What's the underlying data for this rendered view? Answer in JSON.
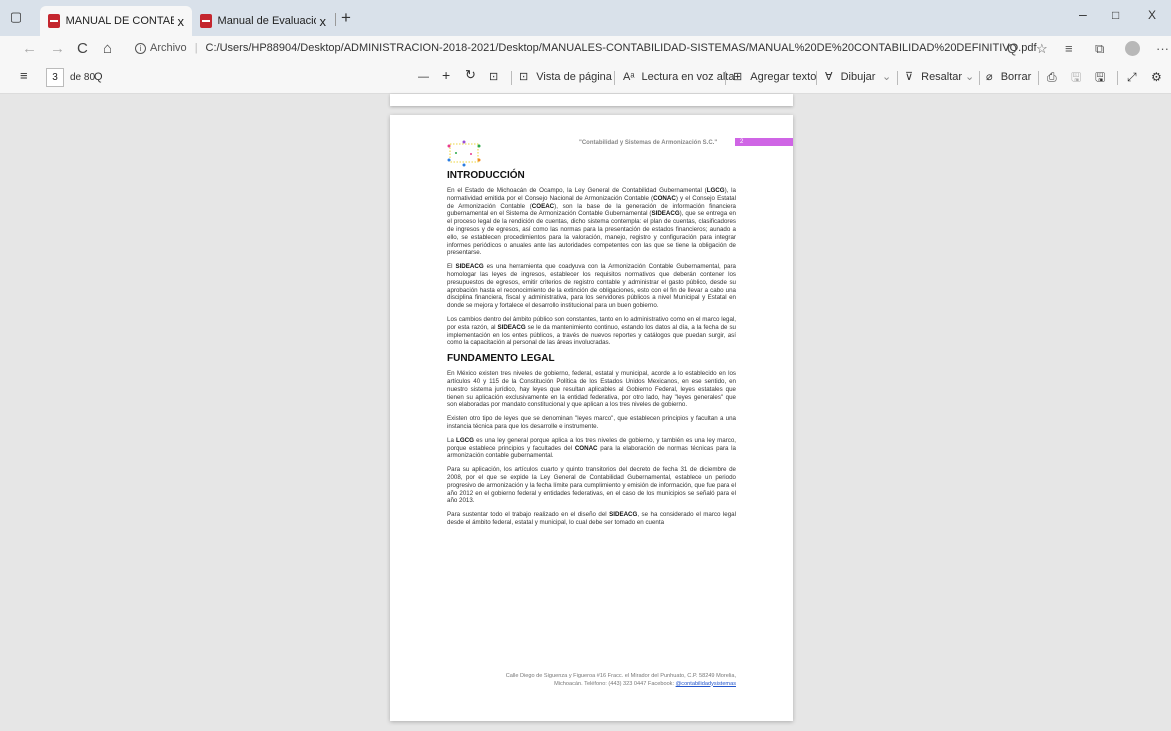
{
  "tabs": [
    {
      "title": "MANUAL DE CONTABILIDAD DE"
    },
    {
      "title": "Manual de Evaluación de Avance"
    }
  ],
  "icons": {
    "back": "←",
    "forward": "→",
    "refresh": "C",
    "home": "⌂",
    "close_tab": "x",
    "new_tab": "+",
    "min": "–",
    "max": "□",
    "close_win": "X",
    "zoom_url": "Q",
    "favorite": "☆",
    "favorites_bar": "≡",
    "collections": "⧉",
    "more": "···",
    "toc": "≡",
    "search": "Q",
    "zoom_out": "—",
    "zoom_in": "+",
    "rotate": "↻",
    "fit": "⊡",
    "page_view": "⊡",
    "read_aloud": "Aᵃ",
    "add_text": "⊞",
    "draw": "∀",
    "highlight": "⊽",
    "chevron": "⌄",
    "erase": "⌀",
    "print": "⎙",
    "save": "🖫",
    "save_as": "🖫",
    "fullscreen": "⤢",
    "settings": "⚙"
  },
  "address": {
    "scheme": "Archivo",
    "url": "C:/Users/HP88904/Desktop/ADMINISTRACION-2018-2021/Desktop/MANUALES-CONTABILIDAD-SISTEMAS/MANUAL%20DE%20CONTABILIDAD%20DEFINITIVO.pdf"
  },
  "pdf_toolbar": {
    "current_page": "3",
    "total_pages": "de 80",
    "page_view": "Vista de página",
    "read_aloud": "Lectura en voz alta",
    "add_text": "Agregar texto",
    "draw": "Dibujar",
    "highlight": "Resaltar",
    "erase": "Borrar"
  },
  "document": {
    "header_text": "\"Contabilidad y Sistemas de Armonización S.C.\"",
    "page_number": "2",
    "sections": {
      "introduccion": {
        "title": "INTRODUCCIÓN",
        "p1": "En el Estado de Michoacán de Ocampo, la Ley General de Contabilidad Gubernamental (LGCG), la normatividad emitida por el Consejo Nacional de Armonización Contable (CONAC) y el Consejo Estatal de Armonización Contable (COEAC), son la base de la generación de información financiera gubernamental en el Sistema de Armonización Contable Gubernamental (SIDEACG), que se entrega en el proceso legal de la rendición de cuentas, dicho sistema contempla: el plan de cuentas, clasificadores de ingresos y de egresos, así como las normas para la presentación de estados financieros; aunado a ello, se establecen procedimientos para la valoración, manejo, registro y configuración para integrar informes periódicos o anuales ante las autoridades competentes con las que se tiene la obligación de presentarse.",
        "p2": "El SIDEACG es una herramienta que coadyuva con la Armonización Contable Gubernamental, para homologar las leyes de ingresos, establecer los requisitos normativos que deberán contener los presupuestos de egresos, emitir criterios de registro contable y administrar el gasto público, desde su aprobación hasta el reconocimiento de la extinción de obligaciones, esto con el fin de llevar a cabo una disciplina financiera, fiscal y administrativa, para los servidores públicos a nivel Municipal y Estatal en donde se mejora y fortalece el desarrollo institucional para un buen gobierno.",
        "p3": "Los cambios dentro del ámbito público son constantes, tanto en lo administrativo como en el marco legal, por esta razón, al SIDEACG se le da mantenimiento continuo, estando los datos al día, a la fecha de su implementación en los entes públicos, a través de nuevos reportes y catálogos que puedan surgir, así como la capacitación al personal de las áreas involucradas."
      },
      "fundamento": {
        "title": "FUNDAMENTO LEGAL",
        "p1": "En México existen tres niveles de gobierno, federal, estatal y municipal, acorde a lo establecido en los artículos 40 y 115 de la Constitución Política de los Estados Unidos Mexicanos, en ese sentido, en nuestro sistema jurídico, hay leyes que resultan aplicables al Gobierno Federal, leyes estatales que tienen su aplicación exclusivamente en la entidad federativa, por otro lado, hay \"leyes generales\" que son elaboradas por mandato constitucional y que aplican a los tres niveles de gobierno.",
        "p2": "Existen otro tipo de leyes que se denominan \"leyes marco\", que establecen principios y facultan a una instancia técnica para que los desarrolle e instrumente.",
        "p3": "La LGCG es una ley general porque aplica a los tres niveles de gobierno, y también es una ley marco, porque establece principios y facultades del CONAC para la elaboración de normas técnicas para la armonización contable gubernamental.",
        "p4": "Para su aplicación, los artículos cuarto y quinto transitorios del decreto de fecha 31 de diciembre de 2008, por el que se expide la Ley General de Contabilidad Gubernamental, establece un periodo progresivo de armonización y la fecha límite para cumplimiento y emisión de información, que fue para el año 2012 en el gobierno federal y entidades federativas, en el caso de los municipios se señaló para el año 2013.",
        "p5": "Para sustentar todo el trabajo realizado en el diseño del SIDEACG, se ha considerado el marco legal desde el ámbito federal, estatal y municipal, lo cual debe ser tomado en cuenta"
      }
    },
    "footer": {
      "line1": "Calle Diego de Siguenza y Figueroa #16 Fracc. el Mirador del Punhuato, C.P. 58249 Morelia,",
      "line2": "Michoacán. Teléfono: (443) 323 0447 Facebook:",
      "link": "@contabilidadysistemas"
    }
  },
  "colors": {
    "tabstrip": "#d9e1ea",
    "toolbar": "#f7f7f7",
    "page_number_bar": "#cf65e5",
    "pdf_icon": "#c4262e",
    "link": "#2255cc"
  }
}
